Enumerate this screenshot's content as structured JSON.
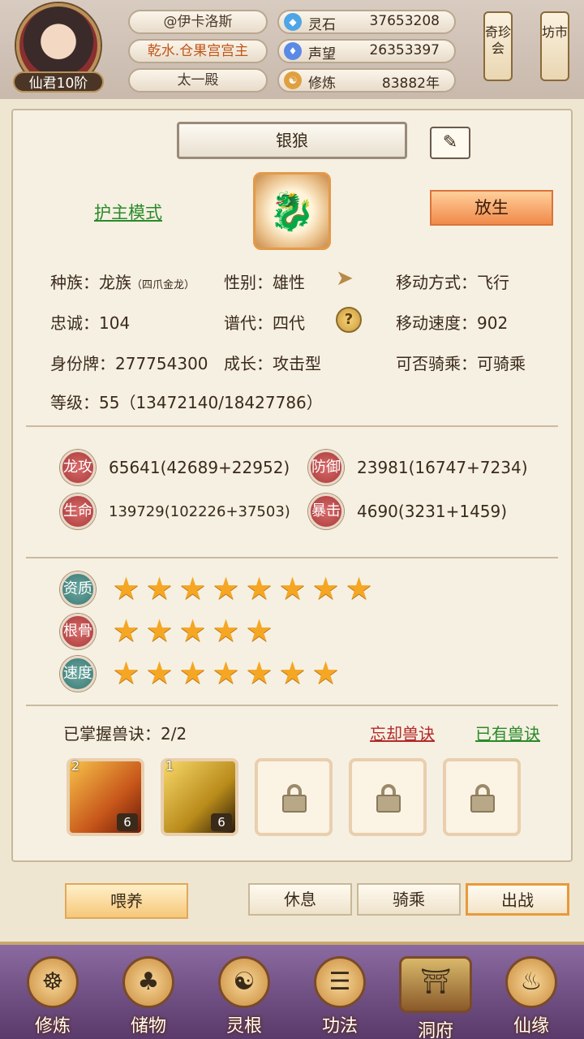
{
  "header": {
    "avatar_rank": "仙君10阶",
    "name_tag": "@伊卡洛斯",
    "title_tag": "乾水.仓果宫宫主",
    "hall_tag": "太一殿",
    "resources": [
      {
        "icon": "crystal-icon",
        "label": "灵石",
        "value": "37653208"
      },
      {
        "icon": "flame-icon",
        "label": "声望",
        "value": "26353397"
      },
      {
        "icon": "meditate-icon",
        "label": "修炼",
        "value": "83882年"
      }
    ],
    "side_buttons": [
      "奇珍会",
      "坊市"
    ]
  },
  "pet": {
    "name": "银狼",
    "mode_link": "护主模式",
    "release_button": "放生",
    "race_label": "种族：",
    "race_value": "龙族",
    "race_sub": "（四爪金龙）",
    "gender_label": "性别：",
    "gender_value": "雄性",
    "move_label": "移动方式：",
    "move_value": "飞行",
    "loyalty_label": "忠诚：",
    "loyalty_value": "104",
    "gen_label": "谱代：",
    "gen_value": "四代",
    "speed_label": "移动速度：",
    "speed_value": "902",
    "id_label": "身份牌：",
    "id_value": "277754300",
    "growth_label": "成长：",
    "growth_value": "攻击型",
    "ride_label": "可否骑乘：",
    "ride_value": "可骑乘",
    "level_label": "等级：",
    "level_value": "55（13472140/18427786）"
  },
  "stats": [
    {
      "badge": "龙攻",
      "value": "65641(42689+22952)"
    },
    {
      "badge": "防御",
      "value": "23981(16747+7234)"
    },
    {
      "badge": "生命",
      "value": "139729(102226+37503)"
    },
    {
      "badge": "暴击",
      "value": "4690(3231+1459)"
    }
  ],
  "ratings": [
    {
      "badge": "资质",
      "stars": 8
    },
    {
      "badge": "根骨",
      "stars": 5
    },
    {
      "badge": "速度",
      "stars": 7
    }
  ],
  "skills": {
    "title": "已掌握兽诀：2/2",
    "forget_link": "忘却兽诀",
    "owned_link": "已有兽诀",
    "slots": [
      {
        "level": "2",
        "count": "6"
      },
      {
        "level": "1",
        "count": "6"
      }
    ]
  },
  "actions": {
    "feed": "喂养",
    "rest": "休息",
    "ride": "骑乘",
    "battle": "出战"
  },
  "nav": [
    "修炼",
    "储物",
    "灵根",
    "功法",
    "洞府",
    "仙缘"
  ]
}
